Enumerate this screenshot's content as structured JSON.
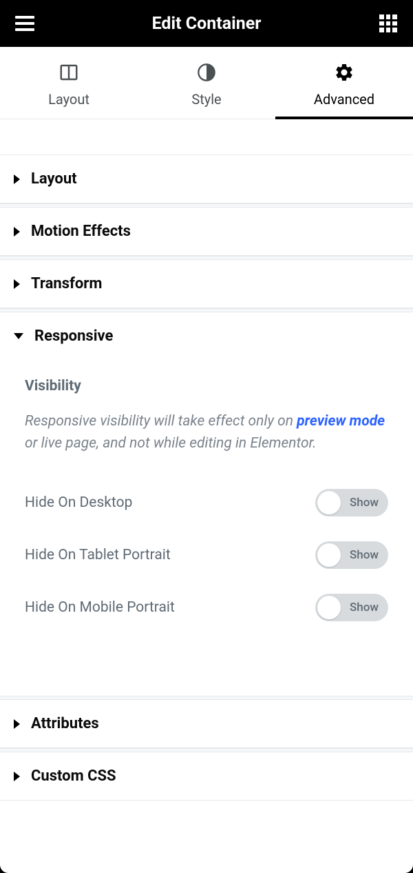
{
  "header": {
    "title": "Edit Container"
  },
  "tabs": {
    "layout": "Layout",
    "style": "Style",
    "advanced": "Advanced"
  },
  "sections": {
    "layout": "Layout",
    "motion_effects": "Motion Effects",
    "transform": "Transform",
    "responsive": "Responsive",
    "attributes": "Attributes",
    "custom_css": "Custom CSS"
  },
  "responsive": {
    "subhead": "Visibility",
    "note_prefix": "Responsive visibility will take effect only on ",
    "note_link": "preview mode",
    "note_suffix": " or live page, and not while editing in Elementor.",
    "toggle_text": "Show",
    "rows": {
      "desktop": "Hide On Desktop",
      "tablet": "Hide On Tablet Portrait",
      "mobile": "Hide On Mobile Portrait"
    }
  }
}
